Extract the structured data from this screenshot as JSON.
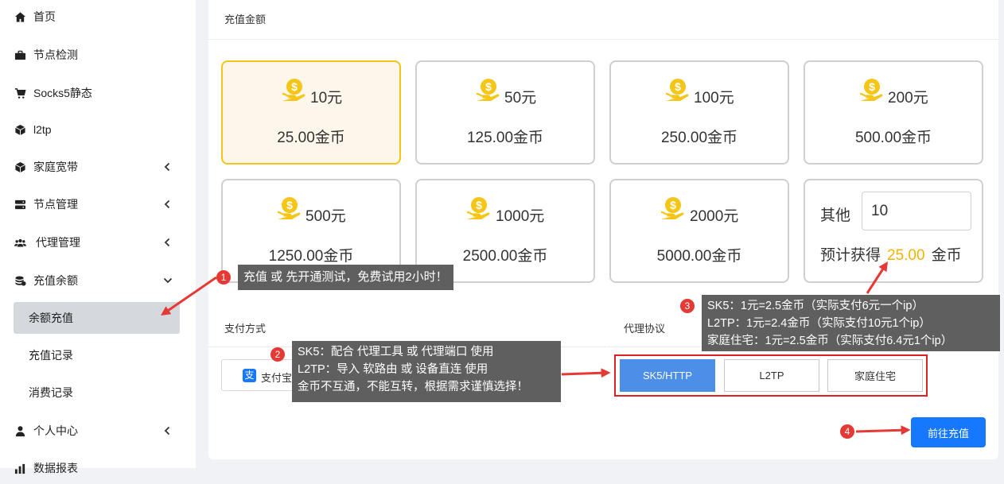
{
  "sidebar": {
    "items": [
      {
        "label": "首页",
        "icon": "home-icon"
      },
      {
        "label": "节点检测",
        "icon": "briefcase-icon"
      },
      {
        "label": "Socks5静态",
        "icon": "cart-icon"
      },
      {
        "label": "l2tp",
        "icon": "cube-icon"
      },
      {
        "label": "家庭宽带",
        "icon": "cube-icon"
      },
      {
        "label": "节点管理",
        "icon": "server-icon"
      },
      {
        "label": "代理管理",
        "icon": "users-icon"
      },
      {
        "label": "充值余额",
        "icon": "coins-icon"
      },
      {
        "label": "个人中心",
        "icon": "user-icon"
      },
      {
        "label": "数据报表",
        "icon": "chart-icon"
      }
    ],
    "sub_items": [
      {
        "label": "余额充值"
      },
      {
        "label": "充值记录"
      },
      {
        "label": "消费记录"
      }
    ]
  },
  "recharge": {
    "title": "充值金额",
    "options": [
      {
        "price": "10元",
        "gold": "25.00金币"
      },
      {
        "price": "50元",
        "gold": "125.00金币"
      },
      {
        "price": "100元",
        "gold": "250.00金币"
      },
      {
        "price": "200元",
        "gold": "500.00金币"
      },
      {
        "price": "500元",
        "gold": "1250.00金币"
      },
      {
        "price": "1000元",
        "gold": "2500.00金币"
      },
      {
        "price": "2000元",
        "gold": "5000.00金币"
      }
    ],
    "selected_index": 0,
    "other": {
      "label": "其他",
      "value": "10",
      "estimate_prefix": "预计获得",
      "estimate_value": "25.00",
      "estimate_suffix": "金币"
    }
  },
  "payment": {
    "label": "支付方式",
    "method": "支付宝",
    "method_visible": "支付宝"
  },
  "protocol": {
    "label": "代理协议",
    "options": [
      "SK5/HTTP",
      "L2TP",
      "家庭住宅"
    ],
    "selected_index": 0
  },
  "submit_label": "前往充值",
  "annotations": [
    {
      "number": "1",
      "lines": [
        "充值 或 先开通测试，免费试用2小时！"
      ]
    },
    {
      "number": "2",
      "lines": [
        "SK5：配合 代理工具 或 代理端口 使用",
        "L2TP：导入 软路由 或 设备直连 使用",
        "金币不互通，不能互转，根据需求谨慎选择！"
      ]
    },
    {
      "number": "3",
      "lines": [
        "SK5：1元=2.5金币（实际支付6元一个ip）",
        "L2TP：1元=2.4金币（实际支付10元1个ip）",
        "家庭住宅：1元=2.5金币（实际支付6.4元1个ip）"
      ]
    },
    {
      "number": "4",
      "lines": []
    }
  ],
  "colors": {
    "accent": "#1677ff",
    "selected_border": "#f5c518",
    "selected_bg": "#fdf6ea",
    "coin": "#f5c518",
    "estimate": "#f5b301",
    "protocol_selected": "#4c8fe8",
    "annotation": "#e53935",
    "callout_bg": "#5f5f5f"
  }
}
